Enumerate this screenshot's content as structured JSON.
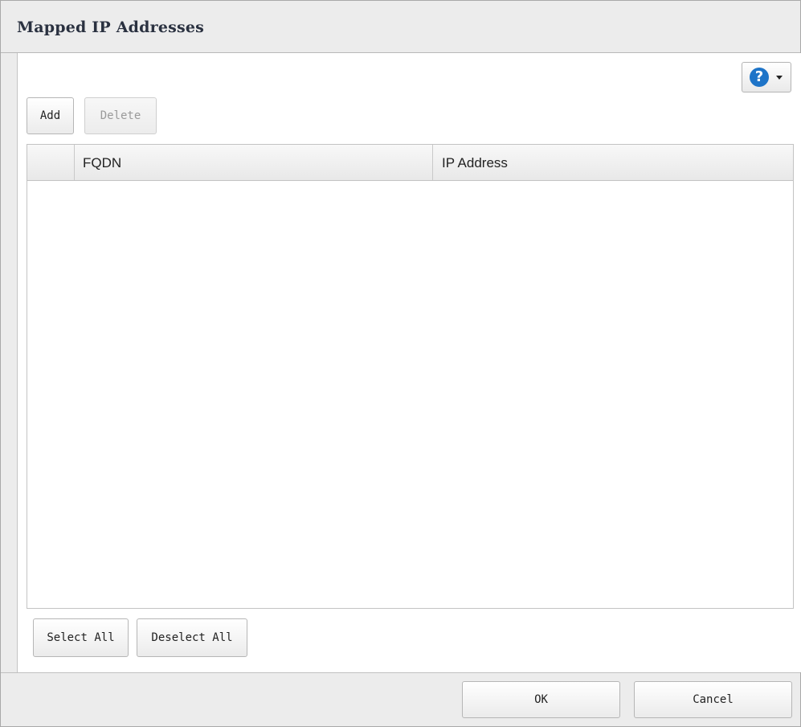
{
  "dialog": {
    "title": "Mapped IP Addresses"
  },
  "toolbar": {
    "help_icon": "question-circle-icon",
    "add_label": "Add",
    "delete_label": "Delete"
  },
  "table": {
    "columns": [
      "",
      "FQDN",
      "IP Address"
    ],
    "rows": []
  },
  "selection": {
    "select_all_label": "Select All",
    "deselect_all_label": "Deselect All"
  },
  "footer": {
    "ok_label": "OK",
    "cancel_label": "Cancel"
  },
  "colors": {
    "help_accent": "#1e74c8",
    "dialog_background": "#ececec"
  }
}
